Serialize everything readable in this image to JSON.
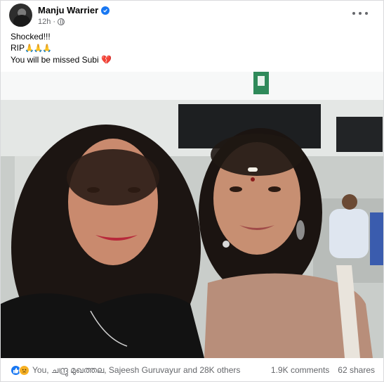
{
  "post": {
    "author": "Manju Warrier",
    "time": "12h",
    "lines": [
      "Shocked!!!",
      "RIP",
      "You will be missed Subi"
    ],
    "pray_emoji": "🙏🙏🙏",
    "heart_emoji": "💔"
  },
  "footer": {
    "reactions_summary": "You, ചന്ദ്രു മുഖത്തല, Sajeesh Guruvayur and 28K others",
    "comments": "1.9K comments",
    "shares": "62 shares"
  },
  "colors": {
    "brand": "#1877f2",
    "muted_text": "#65676b",
    "border": "#d9dadc"
  },
  "icons": [
    "verified-badge-icon",
    "globe-icon",
    "more-options-icon",
    "like-reaction-icon",
    "sad-reaction-icon"
  ]
}
